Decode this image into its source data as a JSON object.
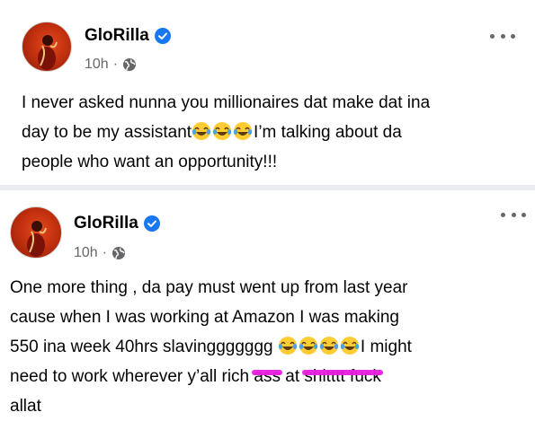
{
  "posts": [
    {
      "author": "GloRilla",
      "verified": true,
      "time": "10h",
      "separator": "·",
      "lines": [
        {
          "text": "I never asked nunna you millionaires dat make dat ina"
        },
        {
          "text_before": "day to be my assistant",
          "emoji_count": 3,
          "text_after": "I’m talking about da"
        },
        {
          "text": "people who want an opportunity!!!"
        }
      ]
    },
    {
      "author": "GloRilla",
      "verified": true,
      "time": "10h",
      "separator": "·",
      "lines": [
        {
          "text": "One more thing , da pay must went up from last year"
        },
        {
          "text": "cause when I was working at Amazon I was making"
        },
        {
          "text_before": "550 ina week 40hrs slavinggggggg ",
          "emoji_count": 4,
          "text_after": "I might"
        },
        {
          "text_before": "need to work wherever y’all rich ",
          "struck_1": "ass",
          "text_mid": " at ",
          "struck_2": "shitttt fuck"
        },
        {
          "text": "allat"
        }
      ]
    }
  ],
  "icons": {
    "verified": "verified-badge-icon",
    "globe": "globe-icon",
    "more": "more-options-icon",
    "emoji": "face-with-tears-of-joy-emoji"
  },
  "colors": {
    "verified_blue": "#1877f2",
    "meta_gray": "#65676b",
    "censor_pink": "#e81ee0"
  }
}
